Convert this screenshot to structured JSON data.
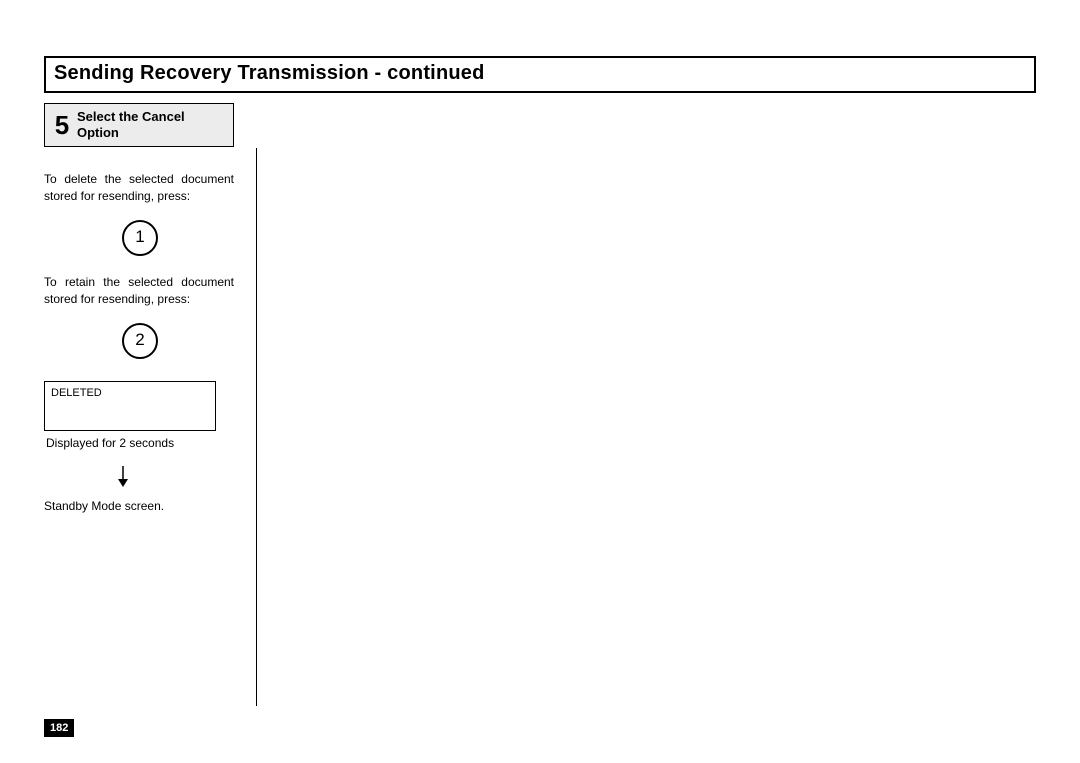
{
  "title": "Sending Recovery Transmission - continued",
  "step": {
    "number": "5",
    "label_line1": "Select the Cancel",
    "label_line2": "Option"
  },
  "para1": "To delete the selected document stored for resending, press:",
  "key1": "1",
  "para2": "To retain the selected document stored for resending, press:",
  "key2": "2",
  "display_text": "DELETED",
  "display_caption": "Displayed for 2 seconds",
  "standby": "Standby Mode screen.",
  "page_number": "182"
}
